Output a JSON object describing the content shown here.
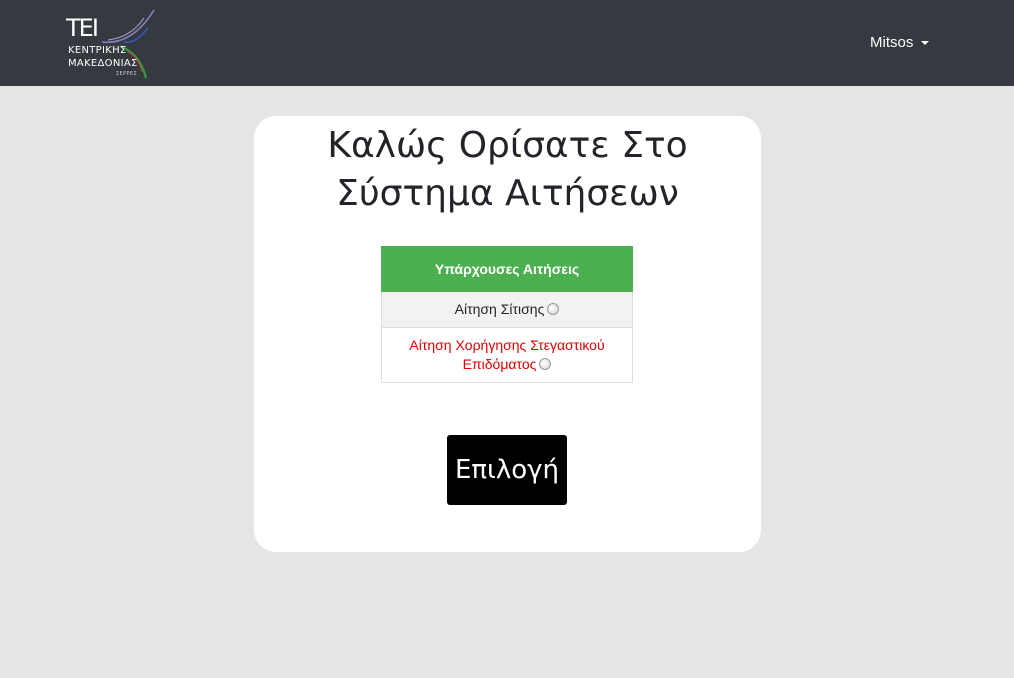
{
  "header": {
    "logo": {
      "line_top": "TEI",
      "line1": "ΚΕΝΤΡΙΚΗΣ",
      "line2": "ΜΑΚΕΔΟΝΙΑΣ",
      "line3": "ΣΕΡΡΕΣ"
    },
    "user_menu_label": "Mitsos"
  },
  "main": {
    "title_line1": "Καλώς Ορίσατε Στο",
    "title_line2": "Σύστημα Αιτήσεων",
    "table": {
      "header": "Υπάρχουσες Αιτήσεις",
      "rows": [
        {
          "label": "Αίτηση Σίτισης",
          "color": "#212529",
          "selected": false
        },
        {
          "label": "Αίτηση Χορήγησης Στεγαστικού Επιδόματος",
          "color": "#e00000",
          "selected": false
        }
      ]
    },
    "submit_label": "Επιλογή"
  },
  "colors": {
    "navbar": "#343a40",
    "background": "#e5e5e5",
    "table_header": "#4caf50",
    "alert_text": "#e00000",
    "button": "#000000"
  }
}
